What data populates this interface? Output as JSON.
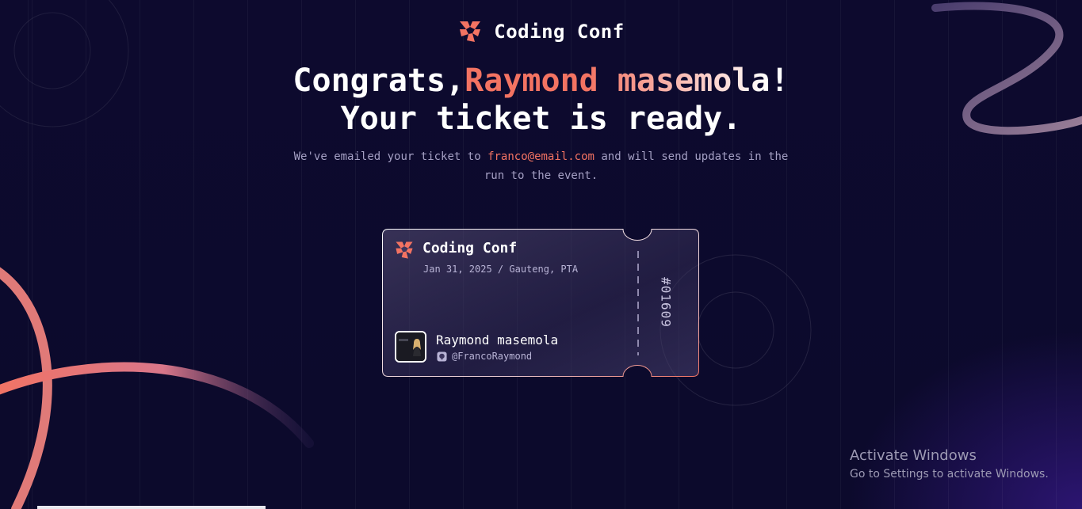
{
  "header": {
    "brand_name": "Coding Conf",
    "logo_icon": "coding-conf-logo-icon",
    "accent_color": "#f37362"
  },
  "headline": {
    "prefix": "Congrats,",
    "name": "Raymond masemola",
    "suffix": "!",
    "line2": "Your ticket is ready."
  },
  "subtext": {
    "before": "We've emailed your ticket to ",
    "email": "franco@email.com",
    "after": " and will send updates in the run to the event."
  },
  "ticket": {
    "title": "Coding Conf",
    "date_location": "Jan 31, 2025 / Gauteng, PTA",
    "attendee_name": "Raymond masemola",
    "github_icon": "github-icon",
    "github_handle": "@FrancoRaymond",
    "ticket_number": "#01609"
  },
  "os_overlay": {
    "title": "Activate Windows",
    "message": "Go to Settings to activate Windows."
  }
}
